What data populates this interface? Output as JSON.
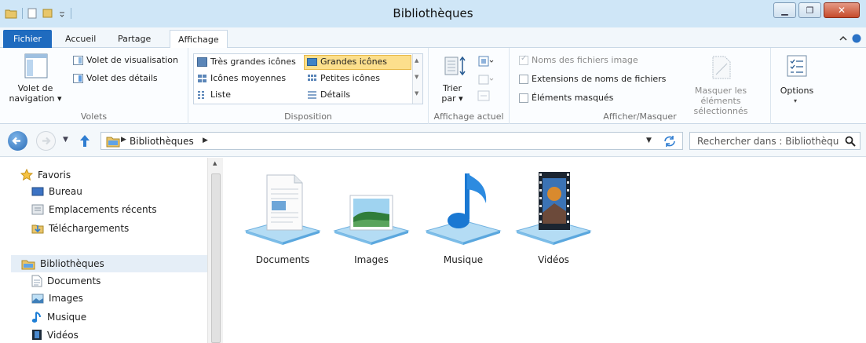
{
  "window": {
    "title": "Bibliothèques"
  },
  "ribbon_tabs": [
    {
      "label": "Fichier"
    },
    {
      "label": "Accueil"
    },
    {
      "label": "Partage"
    },
    {
      "label": "Affichage"
    }
  ],
  "ribbon": {
    "volets": {
      "group_label": "Volets",
      "nav_pane_line1": "Volet de",
      "nav_pane_line2": "navigation",
      "preview_pane": "Volet de visualisation",
      "details_pane": "Volet des détails"
    },
    "disposition": {
      "group_label": "Disposition",
      "items": [
        {
          "label": "Très grandes icônes"
        },
        {
          "label": "Grandes icônes",
          "selected": true
        },
        {
          "label": "Icônes moyennes"
        },
        {
          "label": "Petites icônes"
        },
        {
          "label": "Liste"
        },
        {
          "label": "Détails"
        }
      ]
    },
    "affichage_actuel": {
      "group_label": "Affichage actuel",
      "sort_line1": "Trier",
      "sort_line2": "par"
    },
    "afficher_masquer": {
      "group_label": "Afficher/Masquer",
      "checkboxes": [
        {
          "label": "Noms des fichiers image",
          "enabled": false
        },
        {
          "label": "Extensions de noms de fichiers",
          "enabled": true
        },
        {
          "label": "Éléments masqués",
          "enabled": true
        }
      ],
      "hide_selected_line1": "Masquer les éléments",
      "hide_selected_line2": "sélectionnés"
    },
    "options": {
      "label": "Options"
    }
  },
  "address": {
    "breadcrumb": "Bibliothèques",
    "search_placeholder": "Rechercher dans : Bibliothèqu..."
  },
  "nav_pane": {
    "favorites": {
      "label": "Favoris",
      "items": [
        {
          "label": "Bureau",
          "icon": "desktop-icon"
        },
        {
          "label": "Emplacements récents",
          "icon": "recent-places-icon"
        },
        {
          "label": "Téléchargements",
          "icon": "downloads-icon"
        }
      ]
    },
    "libraries": {
      "label": "Bibliothèques",
      "items": [
        {
          "label": "Documents",
          "icon": "documents-icon"
        },
        {
          "label": "Images",
          "icon": "pictures-icon"
        },
        {
          "label": "Musique",
          "icon": "music-icon"
        },
        {
          "label": "Vidéos",
          "icon": "videos-icon"
        }
      ]
    }
  },
  "content": {
    "items": [
      {
        "label": "Documents",
        "icon": "documents-library-icon"
      },
      {
        "label": "Images",
        "icon": "pictures-library-icon"
      },
      {
        "label": "Musique",
        "icon": "music-library-icon"
      },
      {
        "label": "Vidéos",
        "icon": "videos-library-icon"
      }
    ]
  },
  "colors": {
    "file_tab": "#1f6bbf",
    "titlebar": "#cfe6f7",
    "selection": "#fcdf8c"
  }
}
